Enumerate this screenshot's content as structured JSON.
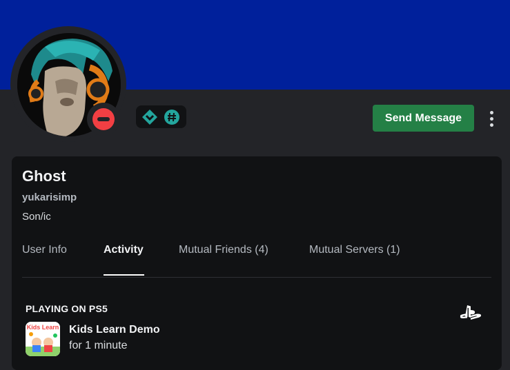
{
  "profile": {
    "display_name": "Ghost",
    "username": "yukarisimp",
    "pronouns": "Son/ic",
    "status": "do-not-disturb",
    "badges": [
      "hypesquad-balance-icon",
      "hashtag-badge-icon"
    ]
  },
  "actions": {
    "send_message_label": "Send Message",
    "more_icon": "vertical-ellipsis-icon"
  },
  "tabs": [
    {
      "label": "User Info",
      "active": false
    },
    {
      "label": "Activity",
      "active": true
    },
    {
      "label": "Mutual Friends (4)",
      "active": false
    },
    {
      "label": "Mutual Servers (1)",
      "active": false
    }
  ],
  "activity": {
    "header": "PLAYING ON PS5",
    "platform_icon": "playstation-icon",
    "game_title": "Kids Learn Demo",
    "game_icon_text": "Kids Learn",
    "duration": "for 1 minute"
  },
  "colors": {
    "banner": "#00209b",
    "background": "#232428",
    "card": "#111214",
    "send_button": "#248046",
    "dnd": "#f23f43",
    "badge_teal": "#23a59d"
  }
}
